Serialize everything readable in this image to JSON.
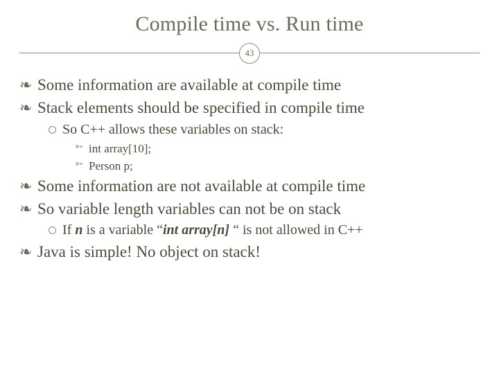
{
  "slide": {
    "title": "Compile time vs. Run time",
    "page_number": "43",
    "bullets": {
      "b1": "Some information are available at compile time",
      "b2": "Stack elements should be specified in compile time",
      "b2_sub1": "So C++ allows these variables on stack:",
      "b2_sub1_a": "int array[10];",
      "b2_sub1_b": "Person p;",
      "b3": "Some information are not available at compile time",
      "b4": "So variable length variables can not be on stack",
      "b4_sub1_pre": "If ",
      "b4_sub1_n": "n",
      "b4_sub1_mid": " is a variable “",
      "b4_sub1_code": "int array[n]",
      "b4_sub1_post": " “ is not allowed in C++",
      "b5": "Java is simple! No object on stack!"
    }
  }
}
